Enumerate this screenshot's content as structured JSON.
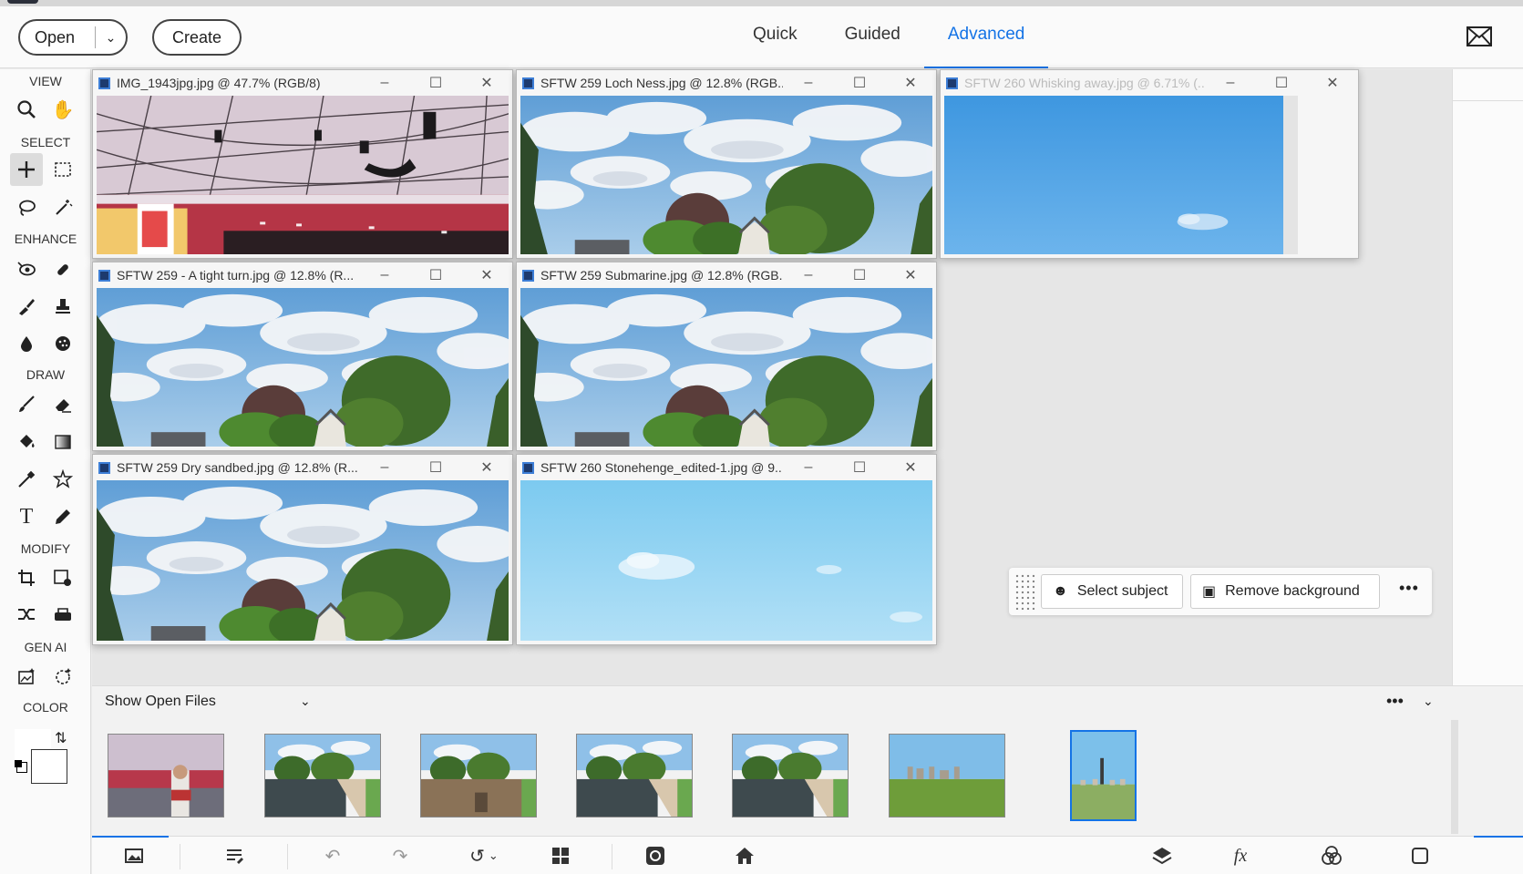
{
  "header": {
    "open_label": "Open",
    "create_label": "Create",
    "modes": [
      "Quick",
      "Guided",
      "Advanced"
    ],
    "active_mode": "Advanced",
    "mail_icon": "mail-icon"
  },
  "toolbar": {
    "sections": {
      "view": "VIEW",
      "select": "SELECT",
      "enhance": "ENHANCE",
      "draw": "DRAW",
      "modify": "MODIFY",
      "gen_ai": "GEN AI",
      "color": "COLOR"
    }
  },
  "documents": [
    {
      "title": "IMG_1943jpg.jpg @ 47.7% (RGB/8)",
      "scene": "stadium"
    },
    {
      "title": "SFTW 259 Loch Ness.jpg @ 12.8% (RGB...",
      "scene": "trees"
    },
    {
      "title": "SFTW 260 Whisking away.jpg @ 6.71% (...",
      "scene": "bluesky"
    },
    {
      "title": "SFTW 259 - A tight turn.jpg @ 12.8% (R...",
      "scene": "trees"
    },
    {
      "title": "SFTW 259 Submarine.jpg @ 12.8% (RGB...",
      "scene": "trees"
    },
    {
      "title": "SFTW 259 Dry sandbed.jpg @ 12.8% (R...",
      "scene": "trees"
    },
    {
      "title": "SFTW 260 Stonehenge_edited-1.jpg @ 9...",
      "scene": "lightsky"
    }
  ],
  "quick_actions": {
    "select_subject": "Select subject",
    "remove_background": "Remove background",
    "more": "•••"
  },
  "photo_bin": {
    "label": "Show Open Files",
    "more": "•••",
    "thumbnail_count": 7,
    "active_index": 6
  },
  "colors": {
    "accent": "#1473e6",
    "sky": "#6fa8dc",
    "foreground": "#ffffff",
    "background": "#ffffff"
  }
}
